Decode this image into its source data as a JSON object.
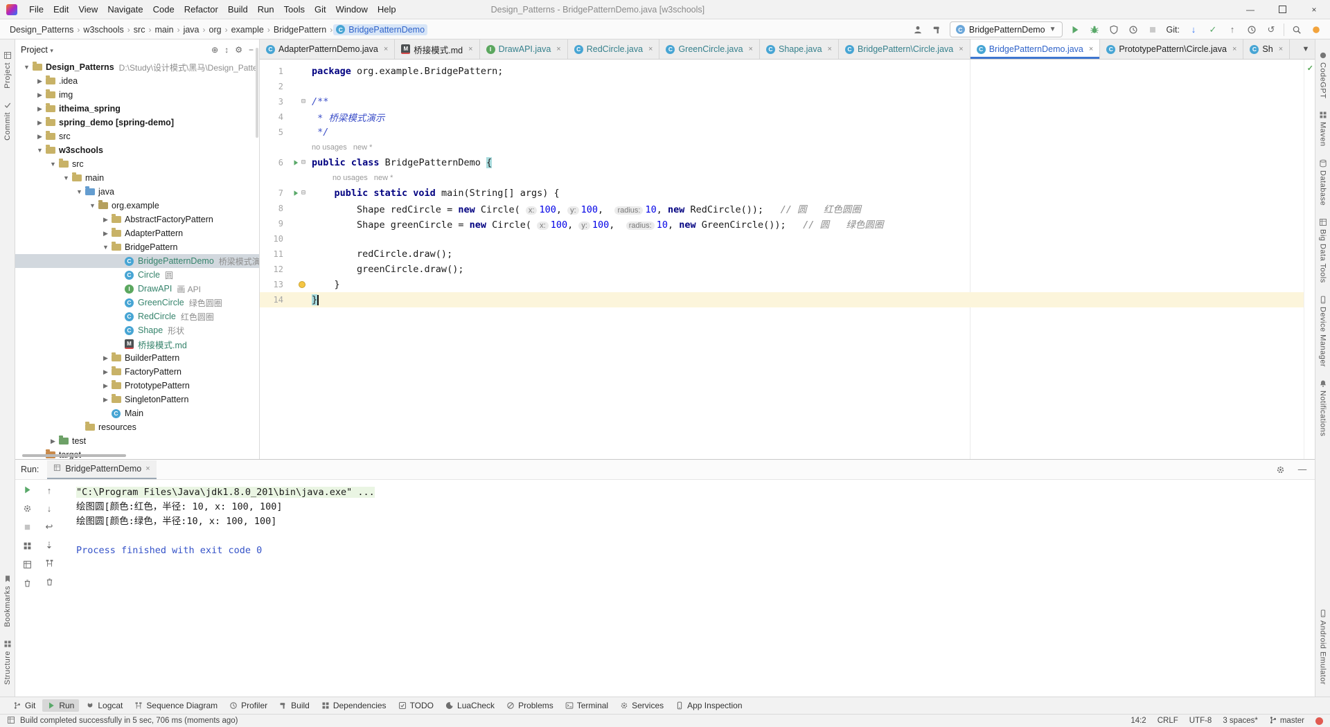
{
  "titlebar": {
    "title": "Design_Patterns - BridgePatternDemo.java [w3schools]",
    "menus": [
      "File",
      "Edit",
      "View",
      "Navigate",
      "Code",
      "Refactor",
      "Build",
      "Run",
      "Tools",
      "Git",
      "Window",
      "Help"
    ]
  },
  "navbar": {
    "breadcrumbs": [
      "Design_Patterns",
      "w3schools",
      "src",
      "main",
      "java",
      "org",
      "example",
      "BridgePattern"
    ],
    "breadcrumb_selected": "BridgePatternDemo",
    "run_config": "BridgePatternDemo",
    "toolbar": [
      {
        "name": "profile-selector",
        "icon": "person"
      },
      {
        "name": "build-project",
        "icon": "hammer"
      },
      {
        "name": "run-config-combo",
        "combo": true
      },
      {
        "name": "run",
        "icon": "play",
        "color": "#59A869"
      },
      {
        "name": "debug",
        "icon": "bug",
        "color": "#59A869"
      },
      {
        "name": "run-with-coverage",
        "icon": "shield",
        "color": "#6E6E6E"
      },
      {
        "name": "profiler",
        "icon": "clock",
        "color": "#6E6E6E"
      },
      {
        "name": "stop",
        "icon": "stop",
        "color": "#C9C9C9"
      },
      {
        "name": "git-label",
        "text": "Git:"
      },
      {
        "name": "git-update",
        "glyph": "↓",
        "color": "#3574F0"
      },
      {
        "name": "git-commit",
        "glyph": "✓",
        "color": "#59A869"
      },
      {
        "name": "git-push",
        "glyph": "↑",
        "color": "#6E6E6E"
      },
      {
        "name": "history",
        "icon": "clock",
        "color": "#6E6E6E"
      },
      {
        "name": "rollback",
        "glyph": "↺",
        "color": "#6E6E6E"
      },
      {
        "name": "separator"
      },
      {
        "name": "search-everywhere",
        "icon": "search",
        "color": "#6E6E6E"
      },
      {
        "name": "codegpt-plugin",
        "icon": "dot",
        "color": "#F2A33C"
      }
    ]
  },
  "left_strip": {
    "top": [
      {
        "label": "Project",
        "icon": "grid"
      },
      {
        "label": "Commit",
        "icon": "check"
      }
    ],
    "bottom": [
      {
        "label": "Bookmarks",
        "icon": "bmark"
      },
      {
        "label": "Structure",
        "icon": "deps"
      }
    ]
  },
  "right_strip": {
    "top": [
      {
        "label": "CodeGPT",
        "icon": "dot"
      },
      {
        "label": "Maven",
        "icon": "deps"
      },
      {
        "label": "Database",
        "icon": "db"
      },
      {
        "label": "Big Data Tools",
        "icon": "grid"
      },
      {
        "label": "Device Manager",
        "icon": "phone"
      },
      {
        "label": "Notifications",
        "icon": "bell"
      }
    ],
    "bottom": [
      {
        "label": "Android Emulator",
        "icon": "phone"
      }
    ]
  },
  "project_panel": {
    "header": "Project",
    "header_icons": [
      {
        "name": "locate-file",
        "glyph": "⊕"
      },
      {
        "name": "expand-collapse",
        "glyph": "↕"
      },
      {
        "name": "settings-gear",
        "glyph": "⚙"
      },
      {
        "name": "hide-panel",
        "glyph": "−"
      }
    ],
    "tree": [
      {
        "l": "Design_Patterns",
        "ann": "D:\\Study\\设计模式\\黑马\\Design_Patte",
        "lvl": 0,
        "icon": "folder",
        "arrow": "open",
        "bold": true
      },
      {
        "l": ".idea",
        "lvl": 1,
        "icon": "folder",
        "arrow": "closed"
      },
      {
        "l": "img",
        "lvl": 1,
        "icon": "folder",
        "arrow": "closed"
      },
      {
        "l": "itheima_spring",
        "lvl": 1,
        "icon": "folder",
        "arrow": "closed",
        "bold": true
      },
      {
        "l": "spring_demo [spring-demo]",
        "lvl": 1,
        "icon": "folder",
        "arrow": "closed",
        "bold": true
      },
      {
        "l": "src",
        "lvl": 1,
        "icon": "folder",
        "arrow": "closed"
      },
      {
        "l": "w3schools",
        "lvl": 1,
        "icon": "folder",
        "arrow": "open",
        "bold": true
      },
      {
        "l": "src",
        "lvl": 2,
        "icon": "folder",
        "arrow": "open"
      },
      {
        "l": "main",
        "lvl": 3,
        "icon": "folder",
        "arrow": "open"
      },
      {
        "l": "java",
        "lvl": 4,
        "icon": "folder-java",
        "arrow": "open"
      },
      {
        "l": "org.example",
        "lvl": 5,
        "icon": "package",
        "arrow": "open"
      },
      {
        "l": "AbstractFactoryPattern",
        "lvl": 6,
        "icon": "folder",
        "arrow": "closed"
      },
      {
        "l": "AdapterPattern",
        "lvl": 6,
        "icon": "folder",
        "arrow": "closed"
      },
      {
        "l": "BridgePattern",
        "lvl": 6,
        "icon": "folder",
        "arrow": "open"
      },
      {
        "l": "BridgePatternDemo",
        "ann": "桥梁模式演示",
        "lvl": 7,
        "icon": "class",
        "vcs": true,
        "selected": true
      },
      {
        "l": "Circle",
        "ann": "圆",
        "lvl": 7,
        "icon": "class",
        "vcs": true
      },
      {
        "l": "DrawAPI",
        "ann": "画 API",
        "lvl": 7,
        "icon": "interface",
        "vcs": true
      },
      {
        "l": "GreenCircle",
        "ann": "绿色圆圈",
        "lvl": 7,
        "icon": "class",
        "vcs": true
      },
      {
        "l": "RedCircle",
        "ann": "红色圆圈",
        "lvl": 7,
        "icon": "class",
        "vcs": true
      },
      {
        "l": "Shape",
        "ann": "形状",
        "lvl": 7,
        "icon": "class",
        "vcs": true
      },
      {
        "l": "桥接模式.md",
        "lvl": 7,
        "icon": "md",
        "vcs": true
      },
      {
        "l": "BuilderPattern",
        "lvl": 6,
        "icon": "folder",
        "arrow": "closed"
      },
      {
        "l": "FactoryPattern",
        "lvl": 6,
        "icon": "folder",
        "arrow": "closed"
      },
      {
        "l": "PrototypePattern",
        "lvl": 6,
        "icon": "folder",
        "arrow": "closed"
      },
      {
        "l": "SingletonPattern",
        "lvl": 6,
        "icon": "folder",
        "arrow": "closed"
      },
      {
        "l": "Main",
        "lvl": 6,
        "icon": "class"
      },
      {
        "l": "resources",
        "lvl": 4,
        "icon": "folder"
      },
      {
        "l": "test",
        "lvl": 2,
        "icon": "folder-test",
        "arrow": "closed"
      },
      {
        "l": "target",
        "lvl": 1,
        "icon": "folder-excluded"
      }
    ]
  },
  "tabs": [
    {
      "label": "AdapterPatternDemo.java",
      "icon": "class",
      "color": "plain"
    },
    {
      "label": "桥接模式.md",
      "icon": "md",
      "color": "plain"
    },
    {
      "label": "DrawAPI.java",
      "icon": "interface",
      "color": "vcs"
    },
    {
      "label": "RedCircle.java",
      "icon": "class",
      "color": "vcs"
    },
    {
      "label": "GreenCircle.java",
      "icon": "class",
      "color": "vcs"
    },
    {
      "label": "Shape.java",
      "icon": "class",
      "color": "vcs"
    },
    {
      "label": "BridgePattern\\Circle.java",
      "icon": "class",
      "color": "vcs"
    },
    {
      "label": "BridgePatternDemo.java",
      "icon": "class",
      "color": "active",
      "active": true
    },
    {
      "label": "PrototypePattern\\Circle.java",
      "icon": "class",
      "color": "plain"
    },
    {
      "label": "Sh",
      "icon": "class",
      "color": "plain"
    }
  ],
  "editor": {
    "rows": [
      {
        "n": 1,
        "segs": [
          {
            "t": "package ",
            "c": "kw"
          },
          {
            "t": "org.example.BridgePattern;",
            "c": "pl"
          }
        ]
      },
      {
        "n": 2,
        "segs": []
      },
      {
        "n": 3,
        "fold": true,
        "segs": [
          {
            "t": "/**",
            "c": "doc"
          }
        ]
      },
      {
        "n": 4,
        "segs": [
          {
            "t": " * 桥梁模式演示",
            "c": "doc"
          }
        ]
      },
      {
        "n": 5,
        "segs": [
          {
            "t": " */",
            "c": "doc"
          }
        ]
      },
      {
        "inlay": "no usages   new *",
        "ind": 0
      },
      {
        "n": 6,
        "run": true,
        "fold": true,
        "segs": [
          {
            "t": "public class ",
            "c": "kw"
          },
          {
            "t": "BridgePatternDemo ",
            "c": "pl"
          },
          {
            "t": "{",
            "c": "brh"
          }
        ]
      },
      {
        "inlay": "no usages   new *",
        "ind": 30
      },
      {
        "n": 7,
        "run": true,
        "fold": true,
        "segs": [
          {
            "t": "    ",
            "c": "pl"
          },
          {
            "t": "public static void ",
            "c": "kw"
          },
          {
            "t": "main(String[] args) {",
            "c": "pl"
          }
        ]
      },
      {
        "n": 8,
        "segs": [
          {
            "t": "        Shape redCircle = ",
            "c": "pl"
          },
          {
            "t": "new ",
            "c": "kw"
          },
          {
            "t": "Circle( ",
            "c": "pl"
          },
          {
            "t": "x:",
            "c": "hint"
          },
          {
            "t": "100",
            "c": "num"
          },
          {
            "t": ", ",
            "c": "pl"
          },
          {
            "t": "y:",
            "c": "hint"
          },
          {
            "t": "100",
            "c": "num"
          },
          {
            "t": ",  ",
            "c": "pl"
          },
          {
            "t": "radius:",
            "c": "hint"
          },
          {
            "t": "10",
            "c": "num"
          },
          {
            "t": ", ",
            "c": "pl"
          },
          {
            "t": "new ",
            "c": "kw"
          },
          {
            "t": "RedCircle());   ",
            "c": "pl"
          },
          {
            "t": "// 圆   红色圆圈",
            "c": "cmt"
          }
        ]
      },
      {
        "n": 9,
        "segs": [
          {
            "t": "        Shape greenCircle = ",
            "c": "pl"
          },
          {
            "t": "new ",
            "c": "kw"
          },
          {
            "t": "Circle( ",
            "c": "pl"
          },
          {
            "t": "x:",
            "c": "hint"
          },
          {
            "t": "100",
            "c": "num"
          },
          {
            "t": ", ",
            "c": "pl"
          },
          {
            "t": "y:",
            "c": "hint"
          },
          {
            "t": "100",
            "c": "num"
          },
          {
            "t": ",  ",
            "c": "pl"
          },
          {
            "t": "radius:",
            "c": "hint"
          },
          {
            "t": "10",
            "c": "num"
          },
          {
            "t": ", ",
            "c": "pl"
          },
          {
            "t": "new ",
            "c": "kw"
          },
          {
            "t": "GreenCircle());   ",
            "c": "pl"
          },
          {
            "t": "// 圆   绿色圆圈",
            "c": "cmt"
          }
        ]
      },
      {
        "n": 10,
        "segs": []
      },
      {
        "n": 11,
        "segs": [
          {
            "t": "        redCircle.draw();",
            "c": "pl"
          }
        ]
      },
      {
        "n": 12,
        "segs": [
          {
            "t": "        greenCircle.draw();",
            "c": "pl"
          }
        ]
      },
      {
        "n": 13,
        "bulb": true,
        "segs": [
          {
            "t": "    }",
            "c": "pl"
          }
        ]
      },
      {
        "n": 14,
        "caret": true,
        "segs": [
          {
            "t": "}",
            "c": "brh"
          }
        ]
      }
    ]
  },
  "run_panel": {
    "label": "Run:",
    "tab": "BridgePatternDemo",
    "toolbar_col1": [
      {
        "name": "rerun",
        "icon": "play",
        "color": "#59A869"
      },
      {
        "name": "run-settings",
        "icon": "gear",
        "color": "#6E6E6E"
      },
      {
        "name": "stop",
        "icon": "stop",
        "color": "#C4C4C4"
      },
      {
        "name": "dump-threads",
        "icon": "deps",
        "color": "#6E6E6E"
      },
      {
        "name": "restore-layout",
        "icon": "grid",
        "color": "#6E6E6E"
      },
      {
        "name": "clear-all",
        "icon": "trash",
        "color": "#6E6E6E"
      }
    ],
    "toolbar_col2": [
      {
        "name": "prev-occurrence",
        "glyph": "↑"
      },
      {
        "name": "next-occurrence",
        "glyph": "↓"
      },
      {
        "name": "soft-wrap",
        "glyph": "↩"
      },
      {
        "name": "scroll-to-end",
        "glyph": "⇣"
      },
      {
        "name": "print",
        "icon": "seq",
        "color": "#6E6E6E"
      },
      {
        "name": "clear",
        "icon": "trash",
        "color": "#6E6E6E"
      }
    ],
    "console": [
      {
        "cls": "cmd",
        "text": "\"C:\\Program Files\\Java\\jdk1.8.0_201\\bin\\java.exe\" ..."
      },
      {
        "cls": "out",
        "text": "绘图圆[颜色:红色，半径: 10, x: 100, 100]"
      },
      {
        "cls": "out",
        "text": "绘图圆[颜色:绿色，半径:10, x: 100, 100]"
      },
      {
        "cls": "out",
        "text": ""
      },
      {
        "cls": "sys",
        "text": "Process finished with exit code 0"
      }
    ]
  },
  "bottom_bar": [
    {
      "label": "Git",
      "icon": "branch"
    },
    {
      "label": "Run",
      "icon": "play",
      "active": true
    },
    {
      "label": "Logcat",
      "icon": "cat"
    },
    {
      "label": "Sequence Diagram",
      "icon": "seq"
    },
    {
      "label": "Profiler",
      "icon": "clock"
    },
    {
      "label": "Build",
      "icon": "hammer"
    },
    {
      "label": "Dependencies",
      "icon": "deps"
    },
    {
      "label": "TODO",
      "icon": "todo"
    },
    {
      "label": "LuaCheck",
      "icon": "moon"
    },
    {
      "label": "Problems",
      "icon": "slash"
    },
    {
      "label": "Terminal",
      "icon": "term"
    },
    {
      "label": "Services",
      "icon": "gear"
    },
    {
      "label": "App Inspection",
      "icon": "phone"
    }
  ],
  "status_bar": {
    "message": "Build completed successfully in 5 sec, 706 ms (moments ago)",
    "caret_pos": "14:2",
    "line_ending": "CRLF",
    "encoding": "UTF-8",
    "indent": "3 spaces*",
    "branch": "master"
  }
}
